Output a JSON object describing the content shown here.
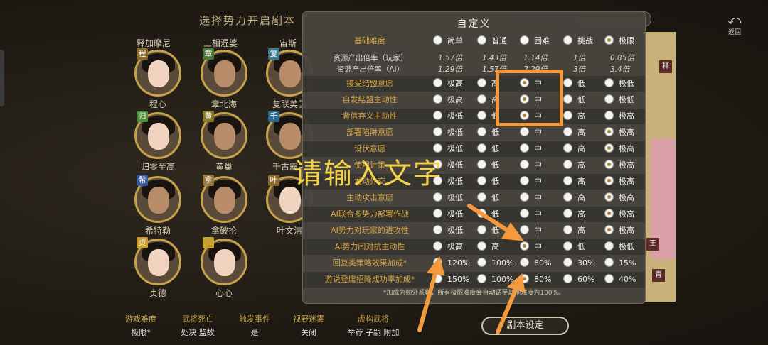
{
  "header": {
    "title": "选择势力开启剧本",
    "back_label": "返回",
    "back_icon": "undo-arrow-icon"
  },
  "top_names": [
    "释加摩尼",
    "三相湿婆",
    "宙斯"
  ],
  "characters": [
    {
      "name": "程心",
      "badge": "程",
      "badge_color": "#8a6a2a",
      "gender": "female"
    },
    {
      "name": "章北海",
      "badge": "章",
      "badge_color": "#4a7a3a",
      "gender": "male"
    },
    {
      "name": "复联美国",
      "badge": "复",
      "badge_color": "#3a7a8a",
      "gender": "male"
    },
    {
      "name": "归零至高",
      "badge": "归",
      "badge_color": "#4a8a3a",
      "gender": "female"
    },
    {
      "name": "黄巢",
      "badge": "黄",
      "badge_color": "#8a7a2a",
      "gender": "male"
    },
    {
      "name": "千古霸主",
      "badge": "千",
      "badge_color": "#2a6a8a",
      "gender": "male"
    },
    {
      "name": "希特勒",
      "badge": "希",
      "badge_color": "#3a5a9a",
      "gender": "male"
    },
    {
      "name": "拿破抡",
      "badge": "拿",
      "badge_color": "#9a7a3a",
      "gender": "male"
    },
    {
      "name": "叶文洁",
      "badge": "叶",
      "badge_color": "#8a6a2a",
      "gender": "female"
    },
    {
      "name": "贞德",
      "badge": "贞",
      "badge_color": "#c8a030",
      "gender": "female"
    },
    {
      "name": "心心",
      "badge": "",
      "badge_color": "#c8a030",
      "gender": "female"
    }
  ],
  "bottom": [
    {
      "key": "游戏难度",
      "value": "极限*"
    },
    {
      "key": "武将死亡",
      "value": "处决 监故"
    },
    {
      "key": "触发事件",
      "value": "是"
    },
    {
      "key": "视野迷雾",
      "value": "关闭"
    },
    {
      "key": "虚构武将",
      "value": "举荐 子嗣 附加"
    }
  ],
  "script_settings_button": "剧本设定",
  "right_tags": [
    "释",
    "王",
    "青"
  ],
  "modal": {
    "title": "自定义",
    "difficulty": {
      "label": "基础难度",
      "options": [
        "简单",
        "普通",
        "困难",
        "挑战",
        "极限"
      ],
      "selected": 4
    },
    "multipliers": [
      {
        "label": "资源产出倍率（玩家）",
        "values": [
          "1.57倍",
          "1.43倍",
          "1.14倍",
          "1倍",
          "0.85倍"
        ]
      },
      {
        "label": "资源产出倍率（AI）",
        "values": [
          "1.29倍",
          "1.57倍",
          "2.29倍",
          "3倍",
          "3.4倍"
        ]
      }
    ],
    "rows": [
      {
        "label": "接受结盟意愿",
        "options": [
          "极高",
          "高",
          "中",
          "低",
          "极低"
        ],
        "selected": 2
      },
      {
        "label": "自发结盟主动性",
        "options": [
          "极高",
          "高",
          "中",
          "低",
          "极低"
        ],
        "selected": 2
      },
      {
        "label": "背信弃义主动性",
        "options": [
          "极低",
          "低",
          "中",
          "高",
          "极高"
        ],
        "selected": 2
      },
      {
        "label": "部署陷阱意愿",
        "options": [
          "极低",
          "低",
          "中",
          "高",
          "极高"
        ],
        "selected": 4
      },
      {
        "label": "设伏意愿",
        "options": [
          "极低",
          "低",
          "中",
          "高",
          "极高"
        ],
        "selected": 4
      },
      {
        "label": "使用计策",
        "options": [
          "极低",
          "低",
          "中",
          "高",
          "极高"
        ],
        "selected": 4
      },
      {
        "label": "发动外交",
        "options": [
          "极低",
          "低",
          "中",
          "高",
          "极高"
        ],
        "selected": 4
      },
      {
        "label": "主动攻击意愿",
        "options": [
          "极低",
          "低",
          "中",
          "高",
          "极高"
        ],
        "selected": 4
      },
      {
        "label": "AI联合多势力部署作战",
        "options": [
          "极低",
          "低",
          "中",
          "高",
          "极高"
        ],
        "selected": 4
      },
      {
        "label": "AI势力对玩家的进攻性",
        "options": [
          "极低",
          "低",
          "中",
          "高",
          "极高"
        ],
        "selected": 4
      },
      {
        "label": "AI势力间对抗主动性",
        "options": [
          "极高",
          "高",
          "中",
          "低",
          "极低"
        ],
        "selected": 2
      },
      {
        "label": "回复类策略效果加成*",
        "options": [
          "120%",
          "100%",
          "60%",
          "30%",
          "15%"
        ],
        "selected": 0
      },
      {
        "label": "游说登庸招降成功率加成*",
        "options": [
          "150%",
          "100%",
          "80%",
          "60%",
          "40%"
        ],
        "selected": 2
      }
    ],
    "footnote": "*加成为额外系数，所有极限难度会自动调至其他难度为100%。"
  },
  "annotation": {
    "overlay_text": "请输入文字",
    "highlight_color": "#f39a3e",
    "text_color": "#f2d24a"
  }
}
